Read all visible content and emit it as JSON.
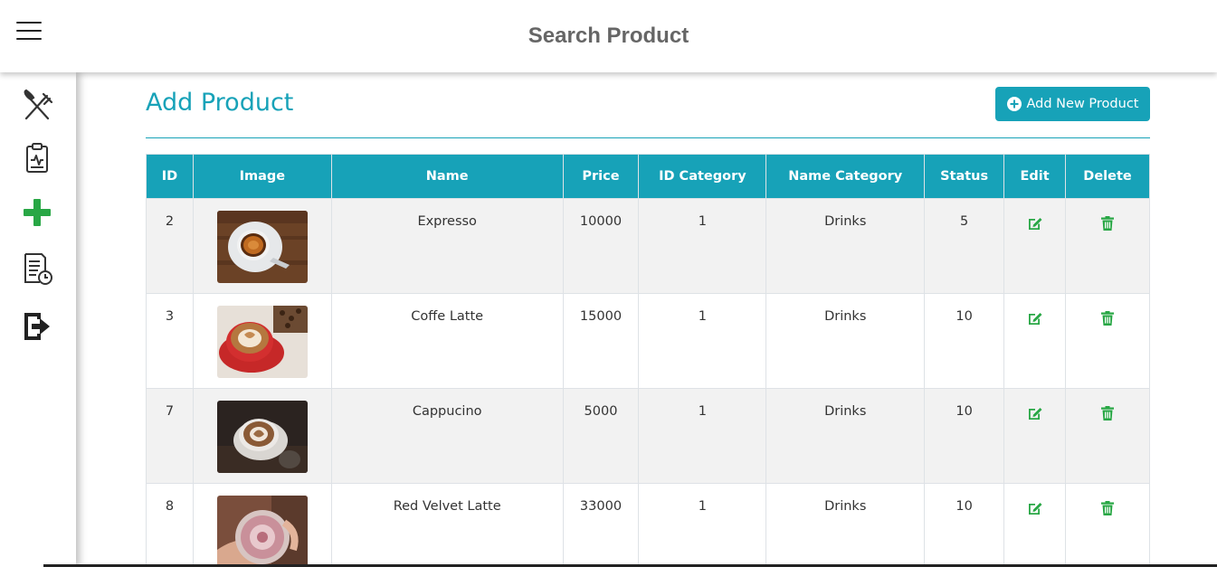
{
  "header": {
    "title": "Search Product",
    "menu_icon": "hamburger-menu-icon"
  },
  "sidebar": {
    "items": [
      {
        "name": "utensils-icon"
      },
      {
        "name": "clipboard-icon"
      },
      {
        "name": "plus-icon"
      },
      {
        "name": "report-history-icon"
      },
      {
        "name": "logout-icon"
      }
    ]
  },
  "main": {
    "title": "Add Product",
    "add_button_label": "Add New Product",
    "accent_color": "#17a2b8",
    "action_color": "#28a745"
  },
  "table": {
    "columns": [
      "ID",
      "Image",
      "Name",
      "Price",
      "ID Category",
      "Name Category",
      "Status",
      "Edit",
      "Delete"
    ],
    "rows": [
      {
        "id": "2",
        "image": "espresso-photo",
        "name": "Expresso",
        "price": "10000",
        "id_category": "1",
        "name_category": "Drinks",
        "status": "5"
      },
      {
        "id": "3",
        "image": "coffee-latte-photo",
        "name": "Coffe Latte",
        "price": "15000",
        "id_category": "1",
        "name_category": "Drinks",
        "status": "10"
      },
      {
        "id": "7",
        "image": "cappuccino-photo",
        "name": "Cappucino",
        "price": "5000",
        "id_category": "1",
        "name_category": "Drinks",
        "status": "10"
      },
      {
        "id": "8",
        "image": "red-velvet-latte-photo",
        "name": "Red Velvet Latte",
        "price": "33000",
        "id_category": "1",
        "name_category": "Drinks",
        "status": "10"
      }
    ]
  }
}
